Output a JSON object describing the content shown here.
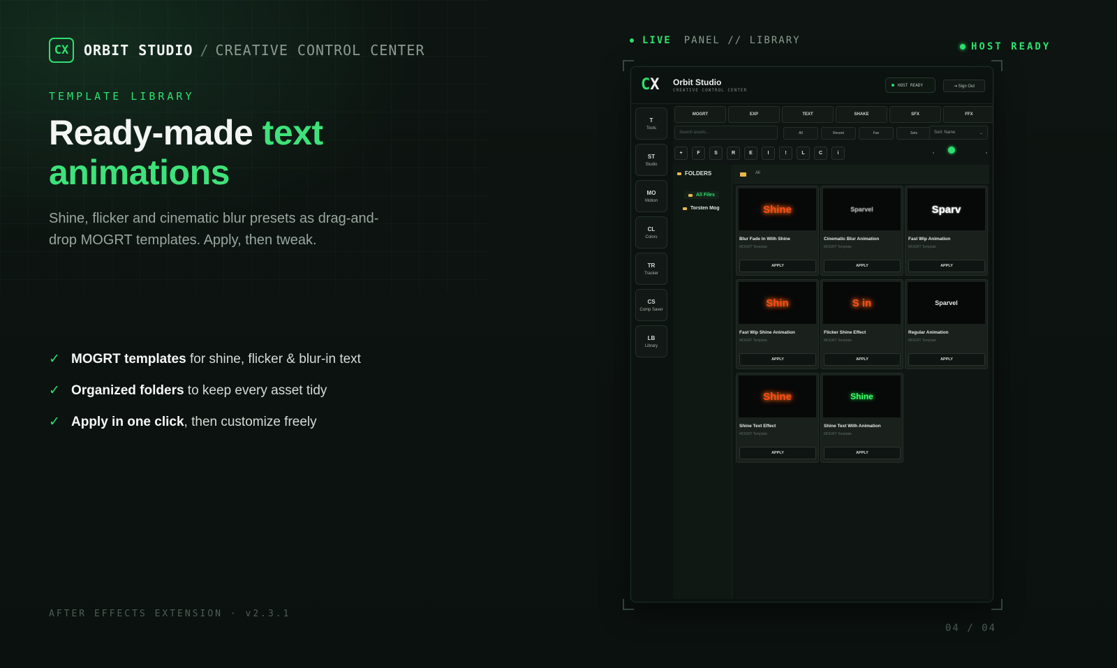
{
  "brand": {
    "logo": "CX",
    "name": "ORBIT STUDIO",
    "separator": "/",
    "subtitle": "CREATIVE CONTROL CENTER"
  },
  "eyebrow": "TEMPLATE LIBRARY",
  "headline": {
    "part1": "Ready-made ",
    "accent1": "text",
    "accent2": "animations"
  },
  "subhead": "Shine, flicker and cinematic blur presets as drag-and-drop MOGRT templates. Apply, then tweak.",
  "features": [
    {
      "bold": "MOGRT templates",
      "rest": " for shine, flicker & blur-in text"
    },
    {
      "bold": "Organized folders",
      "rest": " to keep every asset tidy"
    },
    {
      "bold": "Apply in one click",
      "rest": ", then customize freely"
    }
  ],
  "footer": {
    "left": "AFTER EFFECTS EXTENSION  ·  v2.3.1",
    "pager": "04 / 04"
  },
  "status": {
    "live": "LIVE",
    "panel_path": "PANEL // LIBRARY",
    "host_ready": "HOST READY"
  },
  "panel": {
    "logo_c": "C",
    "logo_x": "X",
    "title": "Orbit Studio",
    "subtitle": "CREATIVE CONTROL CENTER",
    "host_badge": "HOST READY",
    "sign_out": "⇥ Sign Out",
    "rail": [
      {
        "abbr": "T",
        "label": "Tools"
      },
      {
        "abbr": "ST",
        "label": "Studio"
      },
      {
        "abbr": "MO",
        "label": "Motion"
      },
      {
        "abbr": "CL",
        "label": "Colors"
      },
      {
        "abbr": "TR",
        "label": "Tracker"
      },
      {
        "abbr": "CS",
        "label": "Comp Saver"
      },
      {
        "abbr": "LB",
        "label": "Library"
      }
    ],
    "tabs": [
      "MOGRT",
      "EXP",
      "TEXT",
      "SHAKE",
      "SFX",
      "FFX"
    ],
    "search_placeholder": "Search assets...",
    "filters": [
      "All",
      "Recent",
      "Fav",
      "Sets"
    ],
    "sort": "Sort: Name",
    "tools": [
      "+",
      "F",
      "S",
      "R",
      "E",
      "I",
      "!",
      "L",
      "C",
      "i"
    ],
    "folders_title": "FOLDERS",
    "folders": [
      "All Files",
      "Torsten Mog"
    ],
    "breadcrumb": "All",
    "cards": [
      {
        "thumb": "Shine",
        "name": "Blur Fade In With Shine",
        "type": "MOGRT Template",
        "apply": "APPLY"
      },
      {
        "thumb": "Sparvel",
        "name": "Cinematic Blur Animation",
        "type": "MOGRT Template",
        "apply": "APPLY"
      },
      {
        "thumb": "Sparv",
        "name": "Fast Wip Animation",
        "type": "MOGRT Template",
        "apply": "APPLY"
      },
      {
        "thumb": "Shin",
        "name": "Fast Wip Shine Animation",
        "type": "MOGRT Template",
        "apply": "APPLY"
      },
      {
        "thumb": "S in",
        "name": "Flicker Shine Effect",
        "type": "MOGRT Template",
        "apply": "APPLY"
      },
      {
        "thumb": "Sparvel",
        "name": "Regular Animation",
        "type": "MOGRT Template",
        "apply": "APPLY"
      },
      {
        "thumb": "Shine",
        "name": "Shine Text Effect",
        "type": "MOGRT Template",
        "apply": "APPLY"
      },
      {
        "thumb": "Shine",
        "name": "Shine Text With Animation",
        "type": "MOGRT Template",
        "apply": "APPLY"
      }
    ]
  },
  "colors": {
    "accent": "#2ee06f",
    "background": "#0d1411"
  }
}
